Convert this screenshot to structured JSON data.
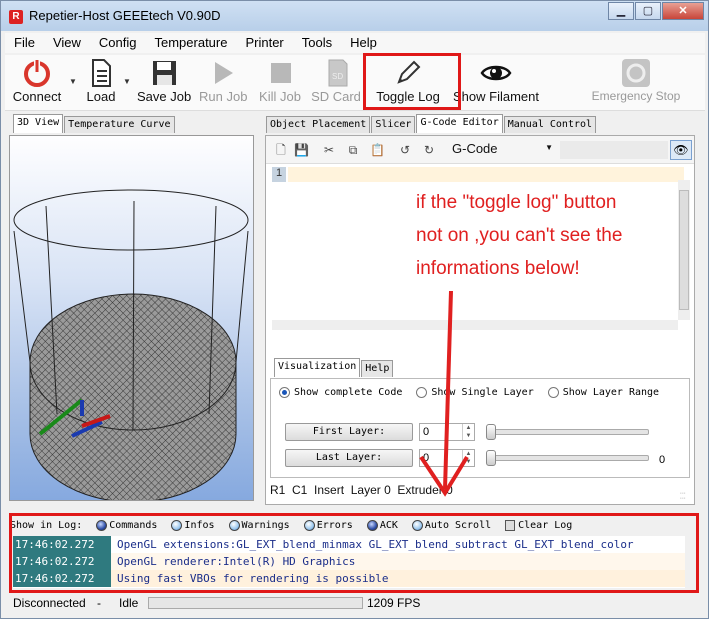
{
  "window": {
    "title": "Repetier-Host GEEEtech V0.90D",
    "app_icon": "R",
    "min_glyph": "▁",
    "max_glyph": "▢",
    "close_glyph": "✕"
  },
  "menu": [
    "File",
    "View",
    "Config",
    "Temperature",
    "Printer",
    "Tools",
    "Help"
  ],
  "toolbar": {
    "connect": "Connect",
    "load": "Load",
    "save_job": "Save Job",
    "run_job": "Run Job",
    "kill_job": "Kill Job",
    "sd_card": "SD Card",
    "toggle_log": "Toggle Log",
    "show_filament": "Show Filament",
    "emergency_stop": "Emergency Stop"
  },
  "left_tabs": [
    "3D View",
    "Temperature Curve"
  ],
  "right_tabs": [
    "Object Placement",
    "Slicer",
    "G-Code Editor",
    "Manual Control"
  ],
  "editor": {
    "gcode_select": "G-Code",
    "line_number": "1"
  },
  "annotation": [
    "if the \"toggle log\" button",
    "not on ,you can't see the",
    "informations below!"
  ],
  "viz_tabs": [
    "Visualization",
    "Help"
  ],
  "radios": [
    "Show complete Code",
    "Show Single Layer",
    "Show Layer Range"
  ],
  "layers": {
    "first_label": "First Layer:",
    "first_value": "0",
    "last_label": "Last Layer:",
    "last_value": "0",
    "slider_value": "0"
  },
  "editor_status": {
    "row": "R1",
    "col": "C1",
    "mode": "Insert",
    "layer": "Layer 0",
    "extruder": "Extruder 0"
  },
  "log_toolbar": {
    "label": "Show in Log:",
    "items": [
      "Commands",
      "Infos",
      "Warnings",
      "Errors",
      "ACK",
      "Auto Scroll"
    ],
    "clear": "Clear Log"
  },
  "log": [
    {
      "time": "17:46:02.272",
      "msg": "OpenGL extensions:GL_EXT_blend_minmax GL_EXT_blend_subtract GL_EXT_blend_color"
    },
    {
      "time": "17:46:02.272",
      "msg": "OpenGL renderer:Intel(R) HD Graphics"
    },
    {
      "time": "17:46:02.272",
      "msg": "Using fast VBOs for rendering is possible"
    }
  ],
  "statusbar": {
    "connection": "Disconnected",
    "sep": "-",
    "state": "Idle",
    "fps": "1209 FPS"
  },
  "colors": {
    "highlight": "#e01818",
    "annotation": "#e02020",
    "timestamp_bg": "#2f7a7f",
    "log_text": "#1b2e8a"
  }
}
